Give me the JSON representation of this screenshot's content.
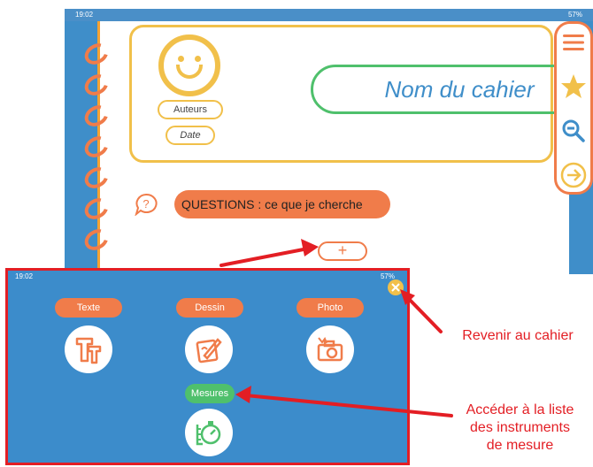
{
  "status_bar_top": {
    "time": "19:02",
    "battery": "57%"
  },
  "notebook": {
    "authors_label": "Auteurs",
    "date_label": "Date",
    "title_placeholder": "Nom du cahier",
    "questions_label": "QUESTIONS : ce que je cherche",
    "add_label": "+"
  },
  "toolbar": {
    "icons": [
      "menu-icon",
      "star-icon",
      "zoom-out-icon",
      "next-arrow-icon"
    ]
  },
  "status_bar_bottom": {
    "time": "19:02",
    "battery": "57%"
  },
  "media_menu": {
    "text_label": "Texte",
    "drawing_label": "Dessin",
    "photo_label": "Photo",
    "measures_label": "Mesures"
  },
  "annotations": {
    "back_label": "Revenir au cahier",
    "measures_line1": "Accéder à la liste",
    "measures_line2": "des instruments",
    "measures_line3": "de mesure"
  },
  "colors": {
    "blue": "#3f8ec9",
    "orange": "#f07c4a",
    "yellow": "#f1c04a",
    "green": "#4fc06c",
    "red": "#e31e24"
  }
}
